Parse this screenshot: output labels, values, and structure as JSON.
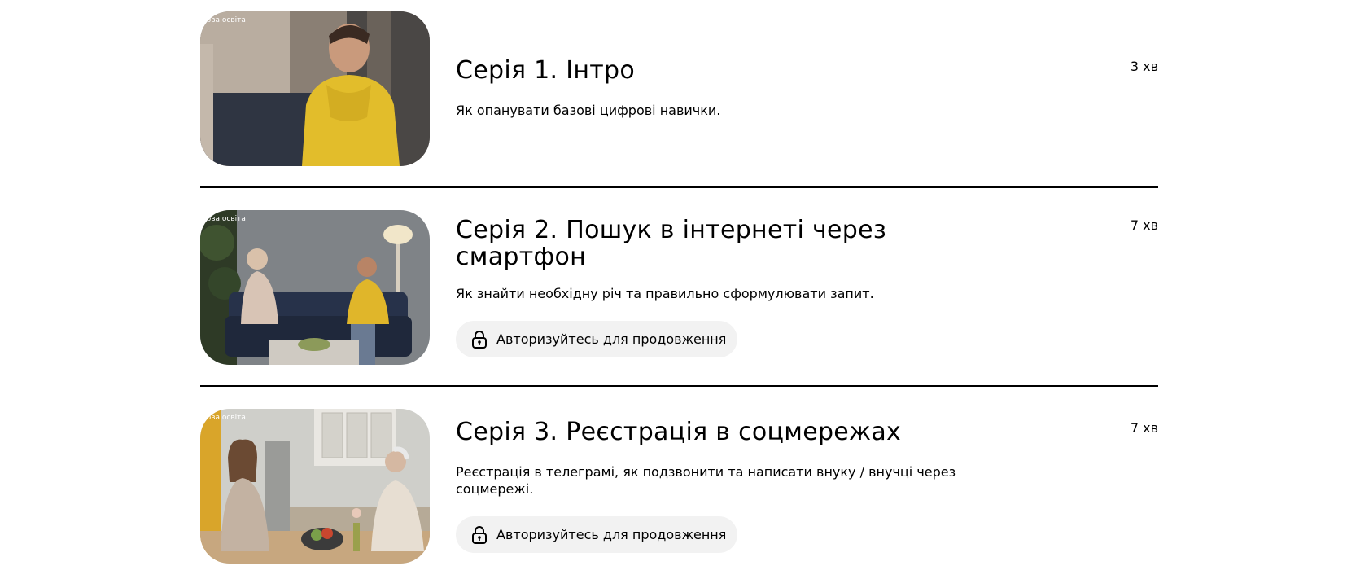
{
  "watermark_text": "рова освіта",
  "episodes": [
    {
      "title": "Серія 1. Інтро",
      "description": "Як опанувати базові цифрові навички.",
      "duration": "3 хв"
    },
    {
      "title": "Серія 2. Пошук в інтернеті через смартфон",
      "description": "Як знайти необхідну річ та правильно сформулювати запит.",
      "duration": "7 хв",
      "auth_label": "Авторизуйтесь для продовження"
    },
    {
      "title": "Серія 3. Реєстрація в соцмережах",
      "description": "Реєстрація в телеграмі, як подзвонити та написати внуку / внучці через соцмережі.",
      "duration": "7 хв",
      "auth_label": "Авторизуйтесь для продовження"
    }
  ],
  "colors": {
    "divider": "#000000",
    "auth_button_bg": "#f2f2f2",
    "hoodie_yellow": "#e8c22c"
  },
  "icons": {
    "auth": "lock-icon"
  }
}
